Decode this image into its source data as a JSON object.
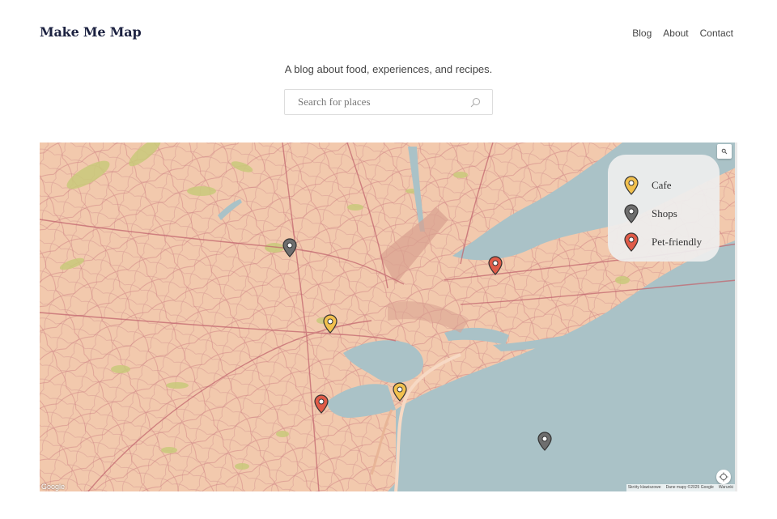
{
  "site": {
    "title": "Make Me Map",
    "tagline": "A blog about food, experiences, and recipes."
  },
  "nav": [
    {
      "label": "Blog"
    },
    {
      "label": "About"
    },
    {
      "label": "Contact"
    }
  ],
  "search": {
    "placeholder": "Search for places",
    "value": "",
    "icon": "search-icon"
  },
  "map": {
    "legend": [
      {
        "label": "Cafe",
        "color": "#f2c14e"
      },
      {
        "label": "Shops",
        "color": "#6e6e6e"
      },
      {
        "label": "Pet-friendly",
        "color": "#e05b48"
      }
    ],
    "google_logo": "Google",
    "attribution": {
      "shortcuts": "Skróty klawiszowe",
      "data": "Dane mapy ©2025 Google",
      "terms": "Warunki"
    },
    "colors": {
      "land": "#f2c9ad",
      "water": "#aac2c7",
      "roads": "#c97a7e",
      "parks": "#c9c97a"
    },
    "icons": {
      "zoom": "magnifier-icon",
      "locate": "crosshair-icon",
      "pin": "map-pin-icon"
    }
  }
}
